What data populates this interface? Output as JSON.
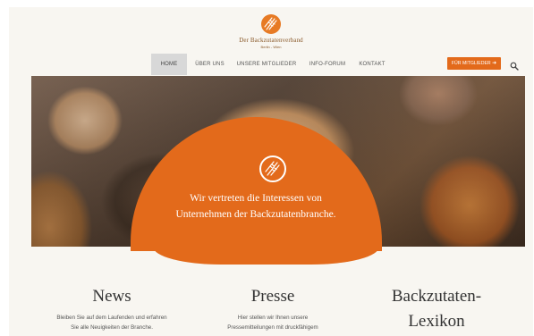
{
  "brand": {
    "name": "Der Backzutatenverband",
    "subtitle": "Berlin - Wien",
    "accent": "#e36a1b"
  },
  "nav": {
    "items": [
      {
        "label": "HOME",
        "active": true
      },
      {
        "label": "ÜBER UNS",
        "active": false
      },
      {
        "label": "UNSERE MITGLIEDER",
        "active": false
      },
      {
        "label": "INFO-FORUM",
        "active": false
      },
      {
        "label": "KONTAKT",
        "active": false
      }
    ],
    "members_button": "FÜR MITGLIEDER",
    "members_icon": "sign-in-icon",
    "search_icon": "search-icon"
  },
  "hero": {
    "tagline_line1": "Wir vertreten die Interessen von",
    "tagline_line2": "Unternehmen der Backzutatenbranche.",
    "icon": "wheat-icon"
  },
  "columns": [
    {
      "title": "News",
      "text_line1": "Bleiben Sie auf dem Laufenden und erfahren",
      "text_line2": "Sie alle Neuigkeiten der Branche."
    },
    {
      "title": "Presse",
      "text_line1": "Hier stellen wir Ihnen unsere",
      "text_line2": "Pressemitteilungen mit druckfähigem"
    },
    {
      "title": "Backzutaten-",
      "title_line2": "Lexikon"
    }
  ]
}
